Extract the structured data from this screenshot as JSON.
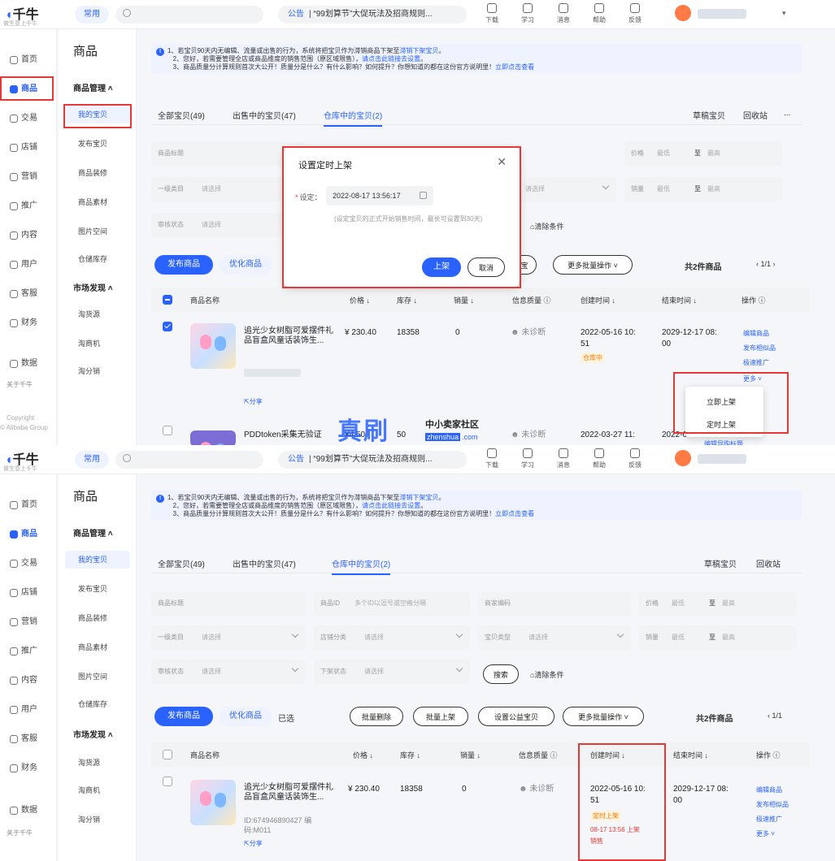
{
  "brand": {
    "logo": "千牛",
    "tagline": "做生意上千牛"
  },
  "header": {
    "common_label": "常用",
    "notice_tag": "公告",
    "notice_text": "“99划算节”大促玩法及招商规则...",
    "tools": [
      {
        "label": "下载",
        "icon": "download-icon"
      },
      {
        "label": "学习",
        "icon": "book-icon"
      },
      {
        "label": "消息",
        "icon": "message-icon"
      },
      {
        "label": "帮助",
        "icon": "help-icon"
      },
      {
        "label": "反馈",
        "icon": "feedback-icon"
      }
    ]
  },
  "sidebar": {
    "items": [
      {
        "label": "首页",
        "icon": "home-icon"
      },
      {
        "label": "商品",
        "icon": "goods-icon"
      },
      {
        "label": "交易",
        "icon": "trade-icon"
      },
      {
        "label": "店铺",
        "icon": "store-icon"
      },
      {
        "label": "营销",
        "icon": "marketing-icon"
      },
      {
        "label": "推广",
        "icon": "promote-icon"
      },
      {
        "label": "内容",
        "icon": "content-icon"
      },
      {
        "label": "用户",
        "icon": "user-icon"
      },
      {
        "label": "客服",
        "icon": "service-icon"
      },
      {
        "label": "财务",
        "icon": "finance-icon"
      },
      {
        "label": "数据",
        "icon": "data-icon"
      }
    ],
    "about": "关于千牛",
    "copyright1": "Copyright",
    "copyright2": "© Alibaba Group"
  },
  "submenu": {
    "title": "商品",
    "group1": "商品管理",
    "group1_items": [
      "我的宝贝",
      "发布宝贝",
      "商品装修",
      "商品素材",
      "图片空间",
      "仓储库存"
    ],
    "group2": "市场发现",
    "group2_items": [
      "淘货源",
      "淘商机",
      "淘分销"
    ]
  },
  "info": {
    "line1": "1、若宝贝90天内无编辑、流量或出售的行为，系统将把宝贝作为滞销商品下架至",
    "line1_link": "滞销下架宝贝",
    "line1_end": "。",
    "line2": "2、您好，若需要管理全店或商品维度的销售范围（原区域限售），",
    "line2_link": "请点击此链接去设置",
    "line2_end": "。",
    "line3": "3、商品质量分计算规则首次大公开！质量分是什么？有什么影响？如何提升？你想知道的都在这份官方说明里！",
    "line3_link": "立即点击查看"
  },
  "tabs": [
    "全部宝贝(49)",
    "出售中的宝贝(47)",
    "仓库中的宝贝(2)"
  ],
  "tabs_right": [
    "草稿宝贝",
    "回收站",
    "..."
  ],
  "filters": {
    "title": "商品标题",
    "id": "商品ID",
    "id_ph": "多个ID以逗号或空格分隔",
    "code": "商家编码",
    "price": "价格",
    "min": "最低",
    "to": "至",
    "max": "最高",
    "cat1": "一级类目",
    "select": "请选择",
    "shopcat": "店铺分类",
    "type": "宝贝类型",
    "sales": "销量",
    "audit": "审核状态",
    "offstatus": "下架状态",
    "search": "搜索",
    "clear": "清除条件"
  },
  "actions": {
    "publish": "发布商品",
    "optimize": "优化商品",
    "selected": "已选",
    "batch_delete": "批量删除",
    "batch_up": "批量上架",
    "charity": "设置公益宝贝",
    "more_batch": "更多批量操作",
    "total": "共2件商品",
    "page": "1/1"
  },
  "table": {
    "headers": [
      "商品名称",
      "价格",
      "库存",
      "销量",
      "信息质量",
      "创建时间",
      "结束时间",
      "操作"
    ],
    "row1": {
      "name": "追光少女树脂可爱摆件礼品盲盒风童话装饰生...",
      "price": "¥ 230.40",
      "stock": "18358",
      "sales": "0",
      "quality": "未诊断",
      "created1": "2022-05-16 10:",
      "created2": "51",
      "end1": "2029-12-17 08:",
      "end2": "00",
      "status1": "仓库中",
      "status2": "定时上架",
      "sched": "08-17 13:56 上架",
      "sched2": "销售",
      "id_line": "ID:674946890427 编",
      "code_line": "码:M011",
      "share": "分享",
      "ops": [
        "编辑商品",
        "发布相似品",
        "极速推广",
        "更多"
      ]
    },
    "row2": {
      "name": "PDDtoken采集无验证",
      "price": "¥4.50",
      "stock": "50",
      "quality": "未诊断",
      "created": "2022-03-27 11:",
      "end": "2022-0",
      "op": "编辑导购标题"
    }
  },
  "dialog": {
    "title": "设置定时上架",
    "label": "设定：",
    "datetime": "2022-08-17 13:56:17",
    "hint": "(设定宝贝的正式开始销售时间，最长可设置到30天)",
    "confirm": "上架",
    "cancel": "取消"
  },
  "more_menu": [
    "立即上架",
    "定时上架"
  ],
  "watermark": {
    "big": "真刷",
    "small": "中小卖家社区",
    "url_tag": "zhenshua",
    "url_rest": ".com"
  }
}
